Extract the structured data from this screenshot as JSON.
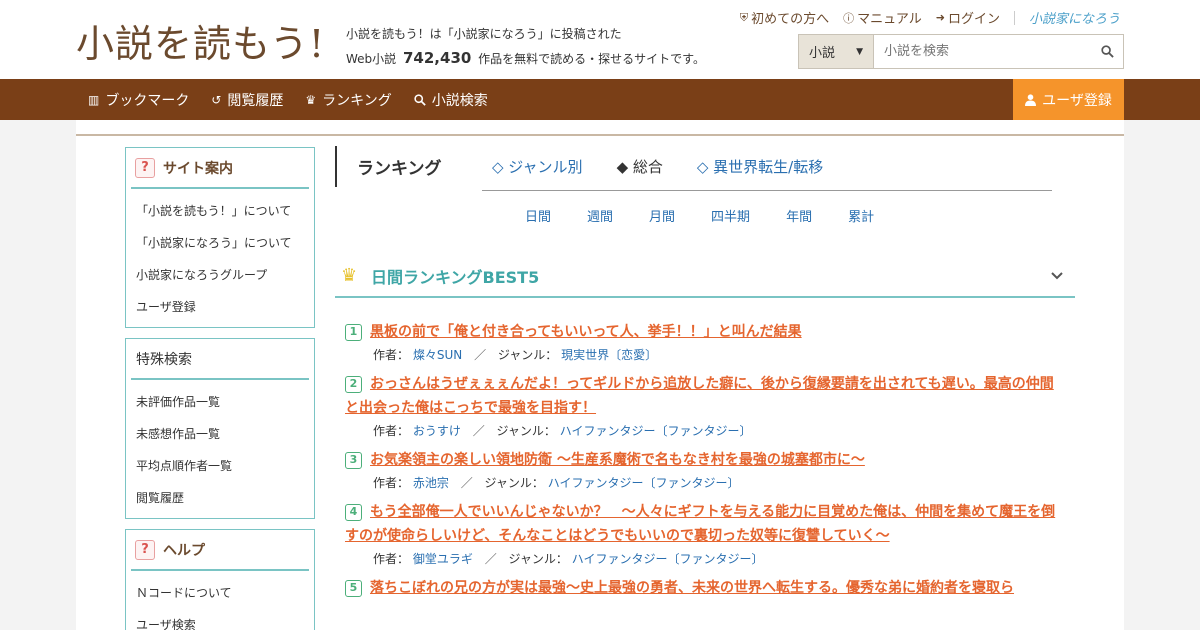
{
  "header": {
    "logo": "小説を読もう!",
    "tagline_line1": "小説を読もう！は「小説家になろう」に投稿された",
    "tagline_prefix": "Web小説",
    "tagline_count": "742,430",
    "tagline_suffix": "作品を無料で読める・探せるサイトです。",
    "links": {
      "first_time": "初めての方へ",
      "manual": "マニュアル",
      "login": "ログイン",
      "brand": "小説家になろう"
    },
    "search": {
      "category": "小説",
      "placeholder": "小説を検索"
    }
  },
  "nav": {
    "bookmark": "ブックマーク",
    "history": "閲覧履歴",
    "ranking": "ランキング",
    "search": "小説検索",
    "register": "ユーザ登録"
  },
  "sidebar": {
    "site_guide": {
      "title": "サイト案内",
      "items": [
        "「小説を読もう！」について",
        "「小説家になろう」について",
        "小説家になろうグループ",
        "ユーザ登録"
      ]
    },
    "special_search": {
      "title": "特殊検索",
      "items": [
        "未評価作品一覧",
        "未感想作品一覧",
        "平均点順作者一覧",
        "閲覧履歴"
      ]
    },
    "help": {
      "title": "ヘルプ",
      "items": [
        "Ｎコードについて",
        "ユーザ検索"
      ]
    }
  },
  "ranking": {
    "title": "ランキング",
    "tabs": [
      "◇ ジャンル別",
      "◆ 総合",
      "◇ 異世界転生/転移"
    ],
    "periods": [
      "日間",
      "週間",
      "月間",
      "四半期",
      "年間",
      "累計"
    ],
    "best_label": "日間ランキングBEST5",
    "author_label": "作者：",
    "genre_label": "ジャンル：",
    "entries": [
      {
        "rank": "1",
        "title": "黒板の前で「俺と付き合ってもいいって人、挙手！！」と叫んだ結果",
        "author": "燦々SUN",
        "genre": "現実世界〔恋愛〕"
      },
      {
        "rank": "2",
        "title": "おっさんはうぜぇぇぇんだよ！ってギルドから追放した癖に、後から復縁要請を出されても遅い。最高の仲間と出会った俺はこっちで最強を目指す！",
        "author": "おうすけ",
        "genre": "ハイファンタジー〔ファンタジー〕"
      },
      {
        "rank": "3",
        "title": "お気楽領主の楽しい領地防衛 〜生産系魔術で名もなき村を最強の城塞都市に〜",
        "author": "赤池宗",
        "genre": "ハイファンタジー〔ファンタジー〕"
      },
      {
        "rank": "4",
        "title": "もう全部俺一人でいいんじゃないか？　～人々にギフトを与える能力に目覚めた俺は、仲間を集めて魔王を倒すのが使命らしいけど、そんなことはどうでもいいので裏切った奴等に復讐していく～",
        "author": "御堂ユラギ",
        "genre": "ハイファンタジー〔ファンタジー〕"
      },
      {
        "rank": "5",
        "title": "落ちこぼれの兄の方が実は最強〜史上最強の勇者、未来の世界へ転生する。優秀な弟に婚約者を寝取ら",
        "author": "",
        "genre": ""
      }
    ]
  }
}
